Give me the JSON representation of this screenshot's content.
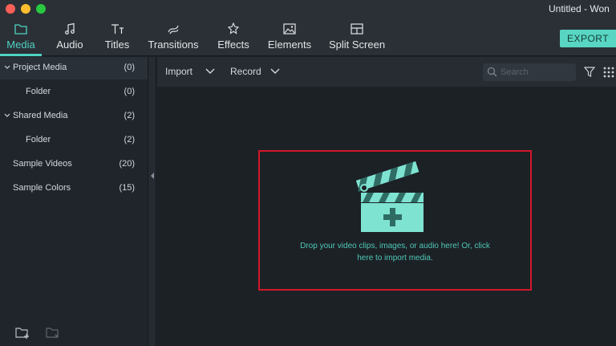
{
  "window": {
    "title": "Untitled - Won"
  },
  "tabs": [
    {
      "label": "Media",
      "icon": "folder-icon",
      "active": true
    },
    {
      "label": "Audio",
      "icon": "music-note-icon",
      "active": false
    },
    {
      "label": "Titles",
      "icon": "titles-icon",
      "active": false
    },
    {
      "label": "Transitions",
      "icon": "transitions-icon",
      "active": false
    },
    {
      "label": "Effects",
      "icon": "effects-icon",
      "active": false
    },
    {
      "label": "Elements",
      "icon": "image-icon",
      "active": false
    },
    {
      "label": "Split Screen",
      "icon": "split-screen-icon",
      "active": false
    }
  ],
  "export_label": "EXPORT",
  "sidebar": {
    "items": [
      {
        "name": "Project Media",
        "count": "(0)",
        "expanded": true
      },
      {
        "name": "Folder",
        "count": "(0)"
      },
      {
        "name": "Shared Media",
        "count": "(2)",
        "expanded": true
      },
      {
        "name": "Folder",
        "count": "(2)"
      },
      {
        "name": "Sample Videos",
        "count": "(20)"
      },
      {
        "name": "Sample Colors",
        "count": "(15)"
      }
    ]
  },
  "media_toolbar": {
    "import_label": "Import",
    "record_label": "Record",
    "search_placeholder": "Search"
  },
  "dropzone": {
    "line1": "Drop your video clips, images, or audio here! Or, click",
    "line2": "here to import media."
  },
  "colors": {
    "accent": "#4fd2c2",
    "highlight_border": "#d0182a"
  }
}
